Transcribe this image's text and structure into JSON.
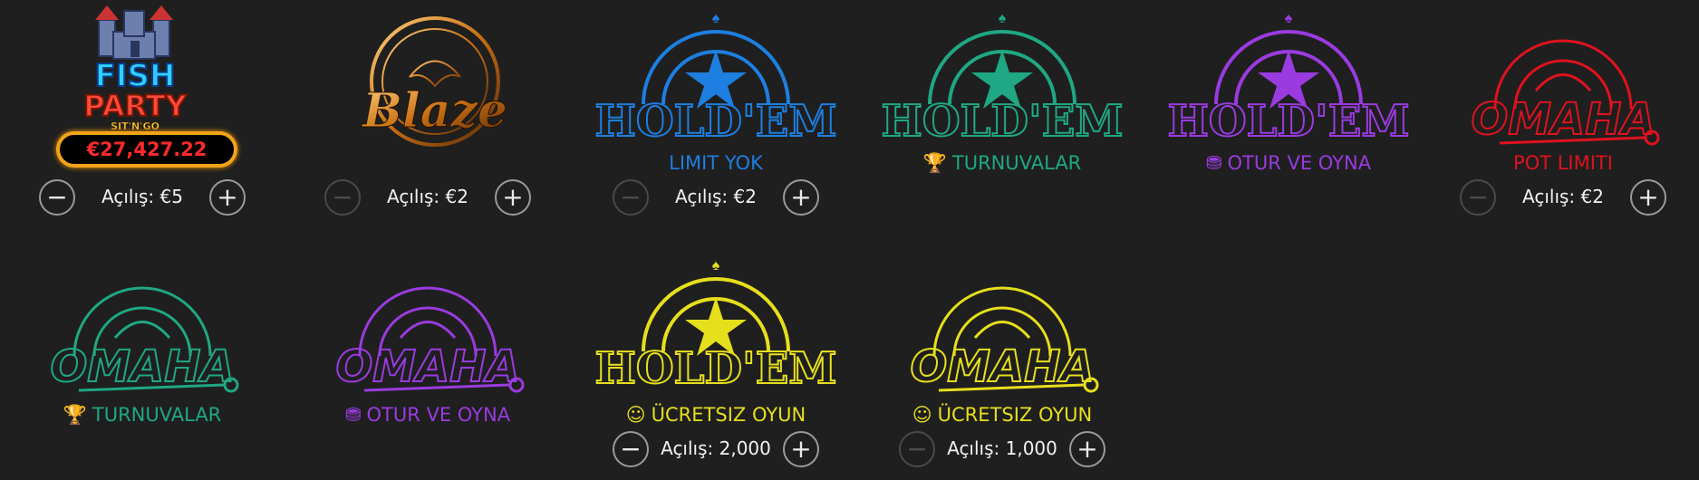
{
  "games": [
    {
      "id": "fish-party",
      "logo_text": [
        "FISH",
        "PARTY",
        "SIT'N'GO"
      ],
      "jackpot": "€27,427.22",
      "ante_label": "Açılış: €5",
      "minus_enabled": true
    },
    {
      "id": "blaze",
      "logo_text": "Blaze",
      "ante_label": "Açılış: €2",
      "minus_enabled": false
    },
    {
      "id": "holdem-blue",
      "logo_text": "HOLD'EM",
      "caption": "LIMIT YOK",
      "caption_icon": "",
      "color": "#1d7fe0",
      "ante_label": "Açılış: €2",
      "minus_enabled": false
    },
    {
      "id": "holdem-green",
      "logo_text": "HOLD'EM",
      "caption": "TURNUVALAR",
      "caption_icon": "trophy-icon",
      "color": "#1fa883"
    },
    {
      "id": "holdem-purple",
      "logo_text": "HOLD'EM",
      "caption": "OTUR VE OYNA",
      "caption_icon": "chips-stack-icon",
      "color": "#9a3be0"
    },
    {
      "id": "omaha-red",
      "logo_text": "OMAHA",
      "caption": "POT LIMITI",
      "caption_icon": "",
      "color": "#e0121e",
      "ante_label": "Açılış: €2",
      "minus_enabled": false
    },
    {
      "id": "omaha-green",
      "logo_text": "OMAHA",
      "caption": "TURNUVALAR",
      "caption_icon": "trophy-icon",
      "color": "#1fa883"
    },
    {
      "id": "omaha-purple",
      "logo_text": "OMAHA",
      "caption": "OTUR VE OYNA",
      "caption_icon": "chips-stack-icon",
      "color": "#9a3be0"
    },
    {
      "id": "holdem-yellow",
      "logo_text": "HOLD'EM",
      "caption": "ÜCRETSIZ OYUN",
      "caption_icon": "smiley-icon",
      "color": "#e6df1c",
      "ante_label": "Açılış: 2,000",
      "minus_enabled": true
    },
    {
      "id": "omaha-yellow",
      "logo_text": "OMAHA",
      "caption": "ÜCRETSIZ OYUN",
      "caption_icon": "smiley-icon",
      "color": "#e6df1c",
      "ante_label": "Açılış: 1,000",
      "minus_enabled": false
    }
  ],
  "glyphs": {
    "minus": "−",
    "plus": "+",
    "trophy": "🏆",
    "chips": "⛃",
    "smiley": "☺"
  }
}
